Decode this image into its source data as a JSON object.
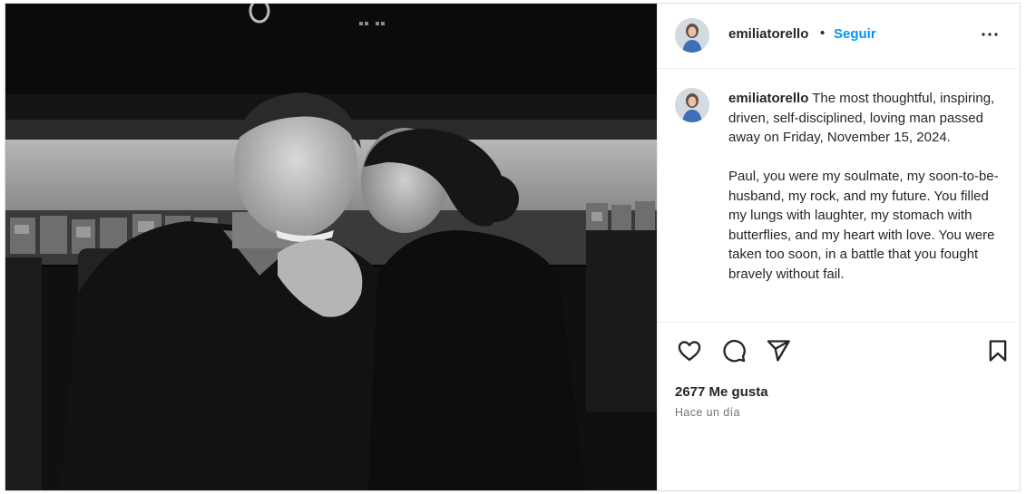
{
  "post": {
    "username": "emiliatorello",
    "separator": "•",
    "follow_label": "Seguir",
    "more_icon": "more-options-icon",
    "caption": {
      "username": "emiliatorello",
      "paragraph1": "The most thoughtful, inspiring, driven, self-disciplined, loving man passed away on Friday, November 15, 2024.",
      "paragraph2": "Paul, you were my soulmate, my soon-to-be-husband, my rock, and my future. You filled my lungs with laughter, my stomach with butterflies, and my heart with love. You were taken too soon, in a battle that you fought bravely without fail."
    },
    "actions": {
      "like_icon": "heart-icon",
      "comment_icon": "comment-icon",
      "share_icon": "share-icon",
      "save_icon": "bookmark-icon"
    },
    "likes_text": "2677 Me gusta",
    "time_text": "Hace un día",
    "colors": {
      "accent": "#0095f6",
      "text": "#262626",
      "muted": "#737373",
      "border": "#dbdbdb"
    }
  }
}
